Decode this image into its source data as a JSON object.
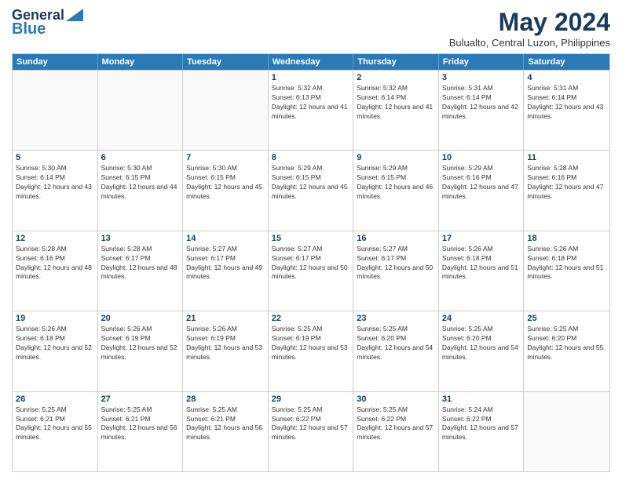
{
  "logo": {
    "line1": "General",
    "line2": "Blue"
  },
  "title": "May 2024",
  "subtitle": "Bulualto, Central Luzon, Philippines",
  "header": {
    "days": [
      "Sunday",
      "Monday",
      "Tuesday",
      "Wednesday",
      "Thursday",
      "Friday",
      "Saturday"
    ]
  },
  "weeks": [
    {
      "cells": [
        {
          "day": "",
          "empty": true
        },
        {
          "day": "",
          "empty": true
        },
        {
          "day": "",
          "empty": true
        },
        {
          "day": "1",
          "sunrise": "5:32 AM",
          "sunset": "6:13 PM",
          "daylight": "12 hours and 41 minutes."
        },
        {
          "day": "2",
          "sunrise": "5:32 AM",
          "sunset": "6:14 PM",
          "daylight": "12 hours and 41 minutes."
        },
        {
          "day": "3",
          "sunrise": "5:31 AM",
          "sunset": "6:14 PM",
          "daylight": "12 hours and 42 minutes."
        },
        {
          "day": "4",
          "sunrise": "5:31 AM",
          "sunset": "6:14 PM",
          "daylight": "12 hours and 43 minutes."
        }
      ]
    },
    {
      "cells": [
        {
          "day": "5",
          "sunrise": "5:30 AM",
          "sunset": "6:14 PM",
          "daylight": "12 hours and 43 minutes."
        },
        {
          "day": "6",
          "sunrise": "5:30 AM",
          "sunset": "6:15 PM",
          "daylight": "12 hours and 44 minutes."
        },
        {
          "day": "7",
          "sunrise": "5:30 AM",
          "sunset": "6:15 PM",
          "daylight": "12 hours and 45 minutes."
        },
        {
          "day": "8",
          "sunrise": "5:29 AM",
          "sunset": "6:15 PM",
          "daylight": "12 hours and 45 minutes."
        },
        {
          "day": "9",
          "sunrise": "5:29 AM",
          "sunset": "6:15 PM",
          "daylight": "12 hours and 46 minutes."
        },
        {
          "day": "10",
          "sunrise": "5:29 AM",
          "sunset": "6:16 PM",
          "daylight": "12 hours and 47 minutes."
        },
        {
          "day": "11",
          "sunrise": "5:28 AM",
          "sunset": "6:16 PM",
          "daylight": "12 hours and 47 minutes."
        }
      ]
    },
    {
      "cells": [
        {
          "day": "12",
          "sunrise": "5:28 AM",
          "sunset": "6:16 PM",
          "daylight": "12 hours and 48 minutes."
        },
        {
          "day": "13",
          "sunrise": "5:28 AM",
          "sunset": "6:17 PM",
          "daylight": "12 hours and 48 minutes."
        },
        {
          "day": "14",
          "sunrise": "5:27 AM",
          "sunset": "6:17 PM",
          "daylight": "12 hours and 49 minutes."
        },
        {
          "day": "15",
          "sunrise": "5:27 AM",
          "sunset": "6:17 PM",
          "daylight": "12 hours and 50 minutes."
        },
        {
          "day": "16",
          "sunrise": "5:27 AM",
          "sunset": "6:17 PM",
          "daylight": "12 hours and 50 minutes."
        },
        {
          "day": "17",
          "sunrise": "5:26 AM",
          "sunset": "6:18 PM",
          "daylight": "12 hours and 51 minutes."
        },
        {
          "day": "18",
          "sunrise": "5:26 AM",
          "sunset": "6:18 PM",
          "daylight": "12 hours and 51 minutes."
        }
      ]
    },
    {
      "cells": [
        {
          "day": "19",
          "sunrise": "5:26 AM",
          "sunset": "6:18 PM",
          "daylight": "12 hours and 52 minutes."
        },
        {
          "day": "20",
          "sunrise": "5:26 AM",
          "sunset": "6:19 PM",
          "daylight": "12 hours and 52 minutes."
        },
        {
          "day": "21",
          "sunrise": "5:26 AM",
          "sunset": "6:19 PM",
          "daylight": "12 hours and 53 minutes."
        },
        {
          "day": "22",
          "sunrise": "5:25 AM",
          "sunset": "6:19 PM",
          "daylight": "12 hours and 53 minutes."
        },
        {
          "day": "23",
          "sunrise": "5:25 AM",
          "sunset": "6:20 PM",
          "daylight": "12 hours and 54 minutes."
        },
        {
          "day": "24",
          "sunrise": "5:25 AM",
          "sunset": "6:20 PM",
          "daylight": "12 hours and 54 minutes."
        },
        {
          "day": "25",
          "sunrise": "5:25 AM",
          "sunset": "6:20 PM",
          "daylight": "12 hours and 55 minutes."
        }
      ]
    },
    {
      "cells": [
        {
          "day": "26",
          "sunrise": "5:25 AM",
          "sunset": "6:21 PM",
          "daylight": "12 hours and 55 minutes."
        },
        {
          "day": "27",
          "sunrise": "5:25 AM",
          "sunset": "6:21 PM",
          "daylight": "12 hours and 56 minutes."
        },
        {
          "day": "28",
          "sunrise": "5:25 AM",
          "sunset": "6:21 PM",
          "daylight": "12 hours and 56 minutes."
        },
        {
          "day": "29",
          "sunrise": "5:25 AM",
          "sunset": "6:22 PM",
          "daylight": "12 hours and 57 minutes."
        },
        {
          "day": "30",
          "sunrise": "5:25 AM",
          "sunset": "6:22 PM",
          "daylight": "12 hours and 57 minutes."
        },
        {
          "day": "31",
          "sunrise": "5:24 AM",
          "sunset": "6:22 PM",
          "daylight": "12 hours and 57 minutes."
        },
        {
          "day": "",
          "empty": true
        }
      ]
    }
  ],
  "labels": {
    "sunrise_prefix": "Sunrise: ",
    "sunset_prefix": "Sunset: ",
    "daylight_prefix": "Daylight: "
  }
}
